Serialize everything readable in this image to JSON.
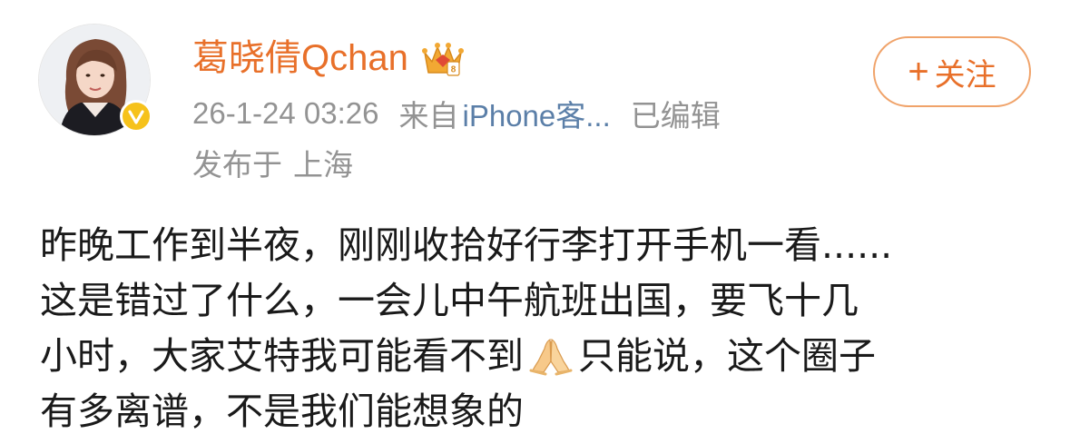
{
  "post": {
    "author": {
      "name": "葛晓倩Qchan",
      "verified": true,
      "avatar": "avatar-photo",
      "badge_icon": "crown-membership-icon"
    },
    "meta": {
      "timestamp": "26-1-24 03:26",
      "source_prefix": "来自",
      "source": "iPhone客...",
      "edited": "已编辑"
    },
    "location": {
      "prefix": "发布于",
      "city": "上海"
    },
    "follow_button": {
      "plus": "+",
      "label": "关注"
    },
    "body": {
      "line1": "昨晚工作到半夜，刚刚收拾好行李打开手机一看......",
      "line2": "这是错过了什么，一会儿中午航班出国，要飞十几",
      "line3_before": "小时，大家艾特我可能看不到",
      "line3_emoji": "praying-hands-emoji",
      "line3_after": "只能说，这个圈子",
      "line4": "有多离谱，不是我们能想象的"
    }
  },
  "colors": {
    "username": "#e8702a",
    "follow_border": "#f0a36a",
    "meta_text": "#939393",
    "source_link": "#5b7fa8",
    "body_text": "#1a1a1a",
    "verified_badge": "#f6c21b"
  }
}
